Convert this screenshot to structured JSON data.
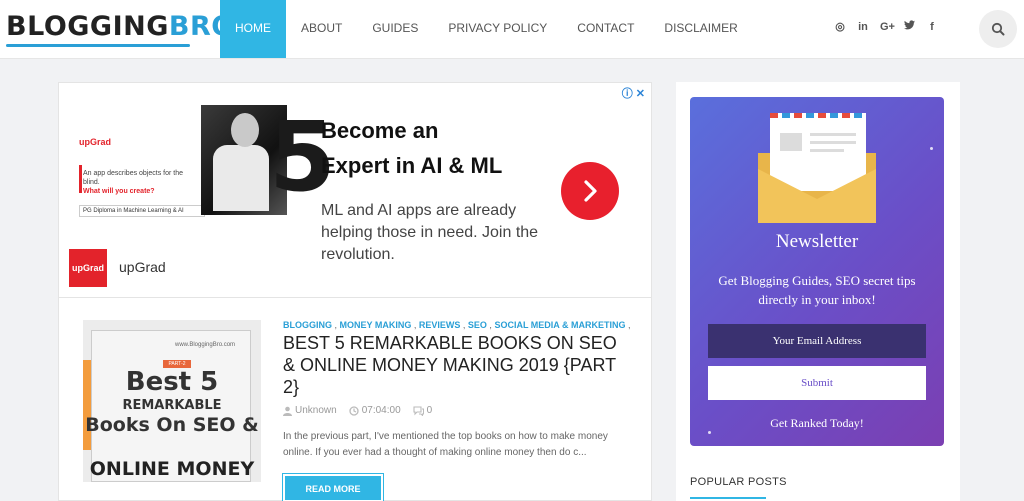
{
  "header": {
    "logo_part1": "BLOGGING",
    "logo_part2": "BRO",
    "nav": [
      "HOME",
      "ABOUT",
      "GUIDES",
      "PRIVACY POLICY",
      "CONTACT",
      "DISCLAIMER"
    ],
    "social_icons": [
      "instagram-icon",
      "linkedin-icon",
      "google-plus-icon",
      "twitter-icon",
      "facebook-icon"
    ],
    "social_glyphs": [
      "◎",
      "in",
      "G+",
      "🐦",
      "f"
    ]
  },
  "ad": {
    "headline_line1": "Become an",
    "headline_line2": "Expert in AI & ML",
    "body": "ML and AI apps are already helping those in need. Join the revolution.",
    "brand": "upGrad",
    "logo_text": "upGrad",
    "choices": "ⓘ ✕",
    "creative_brand": "upGrad",
    "creative_text1": "An app describes objects for the blind.",
    "creative_text2": "What will you create?",
    "creative_pg": "PG Diploma in Machine Learning & AI",
    "creative_big": "5"
  },
  "post": {
    "categories": [
      "BLOGGING",
      "MONEY MAKING",
      "REVIEWS",
      "SEO",
      "SOCIAL MEDIA & MARKETING"
    ],
    "title": "BEST 5 REMARKABLE BOOKS ON SEO & ONLINE MONEY MAKING 2019 {PART 2}",
    "author": "Unknown",
    "time": "07:04:00",
    "comments": "0",
    "excerpt": "In the previous part, I've mentioned the top books on how to make money online. If you ever had a thought of making online money then do c...",
    "read_more": "READ MORE",
    "thumb": {
      "site": "www.BloggingBro.com",
      "tag": "PART-2",
      "line1": "Best 5",
      "line2": "REMARKABLE",
      "line3": "Books On SEO &",
      "line4": "ONLINE MONEY"
    }
  },
  "sidebar": {
    "newsletter_title": "Newsletter",
    "newsletter_sub": "Get Blogging Guides, SEO secret tips directly in your inbox!",
    "email_placeholder": "Your Email Address",
    "submit": "Submit",
    "footer": "Get Ranked Today!",
    "popular_title": "POPULAR POSTS"
  },
  "colors": {
    "accent": "#30b6e4",
    "ad_red": "#e8202d",
    "newsletter_gradient": [
      "#5a6fdc",
      "#7b3fb2"
    ]
  }
}
